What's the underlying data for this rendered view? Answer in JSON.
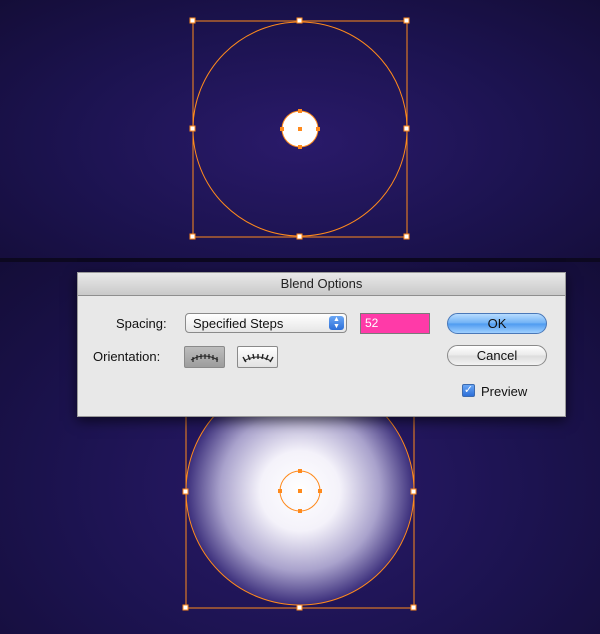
{
  "dialog": {
    "title": "Blend Options",
    "spacing_label": "Spacing:",
    "spacing_value": "Specified Steps",
    "steps_value": "52",
    "orientation_label": "Orientation:",
    "ok_label": "OK",
    "cancel_label": "Cancel",
    "preview_label": "Preview",
    "preview_checked": true
  },
  "colors": {
    "canvas_bg": "#1c1350",
    "selection": "#ff8a1c",
    "steps_highlight": "#ff3aa8"
  }
}
